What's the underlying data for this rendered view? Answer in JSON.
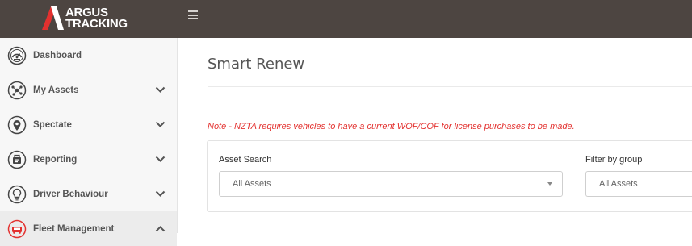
{
  "brand": {
    "line1": "ARGUS",
    "line2": "TRACKING",
    "accent_color": "#e3312f"
  },
  "topbar": {
    "background": "#4d4541",
    "menu_icon": "hamburger-icon"
  },
  "sidebar": {
    "items": [
      {
        "label": "Dashboard",
        "icon": "speedometer-icon",
        "expandable": false
      },
      {
        "label": "My Assets",
        "icon": "network-icon",
        "expandable": true,
        "expanded": false
      },
      {
        "label": "Spectate",
        "icon": "map-pin-icon",
        "expandable": true,
        "expanded": false
      },
      {
        "label": "Reporting",
        "icon": "report-icon",
        "expandable": true,
        "expanded": false
      },
      {
        "label": "Driver Behaviour",
        "icon": "lightbulb-icon",
        "expandable": true,
        "expanded": false
      },
      {
        "label": "Fleet Management",
        "icon": "fleet-icon",
        "expandable": true,
        "expanded": true
      }
    ]
  },
  "main": {
    "title": "Smart Renew",
    "note": "Note - NZTA requires vehicles to have a current WOF/COF for license purchases to be made.",
    "asset_search": {
      "label": "Asset Search",
      "value": "All Assets"
    },
    "filter_group": {
      "label": "Filter by group",
      "value": "All Assets"
    }
  }
}
